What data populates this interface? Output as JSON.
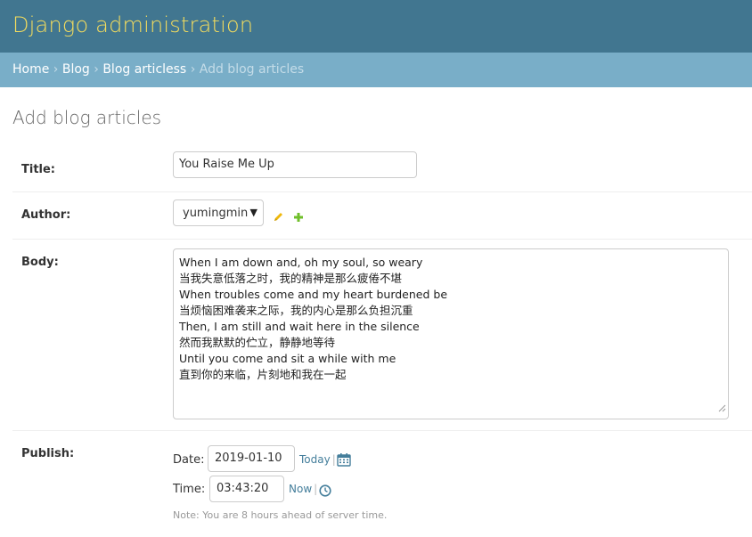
{
  "header": {
    "site_title": "Django administration"
  },
  "breadcrumbs": {
    "home": "Home",
    "app": "Blog",
    "model": "Blog articless",
    "current": "Add blog articles",
    "separator": "›"
  },
  "page_title": "Add blog articles",
  "form": {
    "title": {
      "label": "Title:",
      "value": "You Raise Me Up"
    },
    "author": {
      "label": "Author:",
      "value": "yumingmin",
      "change_icon": "pencil-icon",
      "add_icon": "plus-icon"
    },
    "body": {
      "label": "Body:",
      "lines": [
        "When I am down and, oh my soul, so weary",
        "当我失意低落之时，我的精神是那么疲倦不堪",
        "When troubles come and my heart burdened be",
        "当烦恼困难袭来之际，我的内心是那么负担沉重",
        "Then, I am still and wait here in the silence",
        "然而我默默的伫立，静静地等待",
        "Until you come and sit a while with me",
        "直到你的来临，片刻地和我在一起"
      ]
    },
    "publish": {
      "label": "Publish:",
      "date_label": "Date:",
      "date_value": "2019-01-10",
      "today_link": "Today",
      "calendar_icon": "calendar-icon",
      "time_label": "Time:",
      "time_value": "03:43:20",
      "now_link": "Now",
      "clock_icon": "clock-icon",
      "separator": "|",
      "note": "Note: You are 8 hours ahead of server time."
    }
  },
  "colors": {
    "header_bg": "#417690",
    "site_title": "#f5dd5d",
    "breadcrumb_bg": "#79aec8",
    "link": "#447e9b",
    "add_green": "#70bf2b",
    "edit_yellow": "#efb80b"
  }
}
